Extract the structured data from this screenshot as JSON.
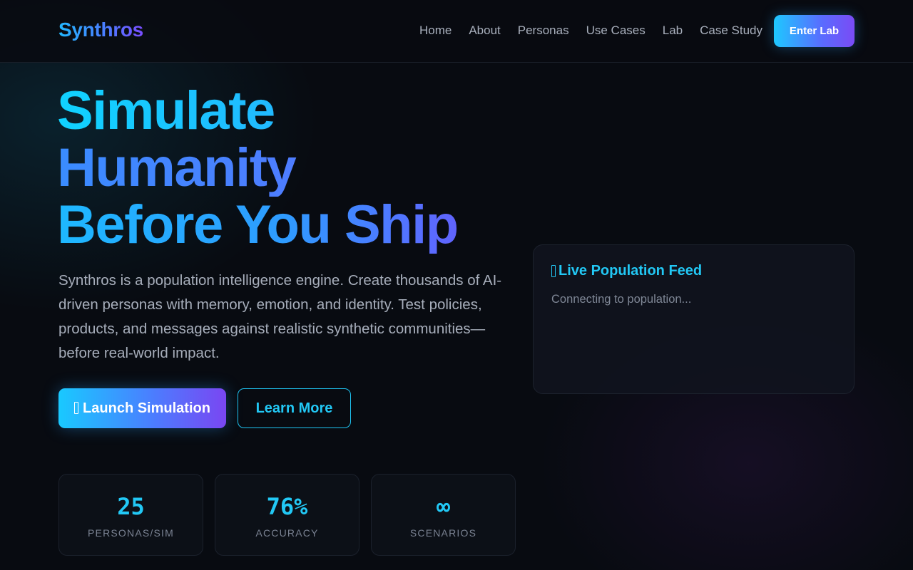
{
  "nav": {
    "logo": "Synthros",
    "links": [
      "Home",
      "About",
      "Personas",
      "Use Cases",
      "Lab",
      "Case Study"
    ],
    "cta": "Enter Lab"
  },
  "hero": {
    "title_lines": [
      "Simulate",
      "Humanity",
      "Before You Ship"
    ],
    "description": "Synthros is a population intelligence engine. Create thousands of AI-driven personas with memory, emotion, and identity. Test policies, products, and messages against realistic synthetic communities—before real-world impact.",
    "primary_button": "Launch Simulation",
    "primary_button_icon": "rocket-icon",
    "secondary_button": "Learn More"
  },
  "stats": [
    {
      "value": "25",
      "label": "PERSONAS/SIM"
    },
    {
      "value": "76%",
      "label": "ACCURACY"
    },
    {
      "value": "∞",
      "label": "SCENARIOS"
    }
  ],
  "feed": {
    "icon": "broadcast-icon",
    "title": "Live Population Feed",
    "status": "Connecting to population..."
  },
  "colors": {
    "background": "#080b11",
    "accent_cyan": "#22c8f5",
    "accent_violet": "#7a46f2",
    "muted_text": "#a7aebb"
  }
}
